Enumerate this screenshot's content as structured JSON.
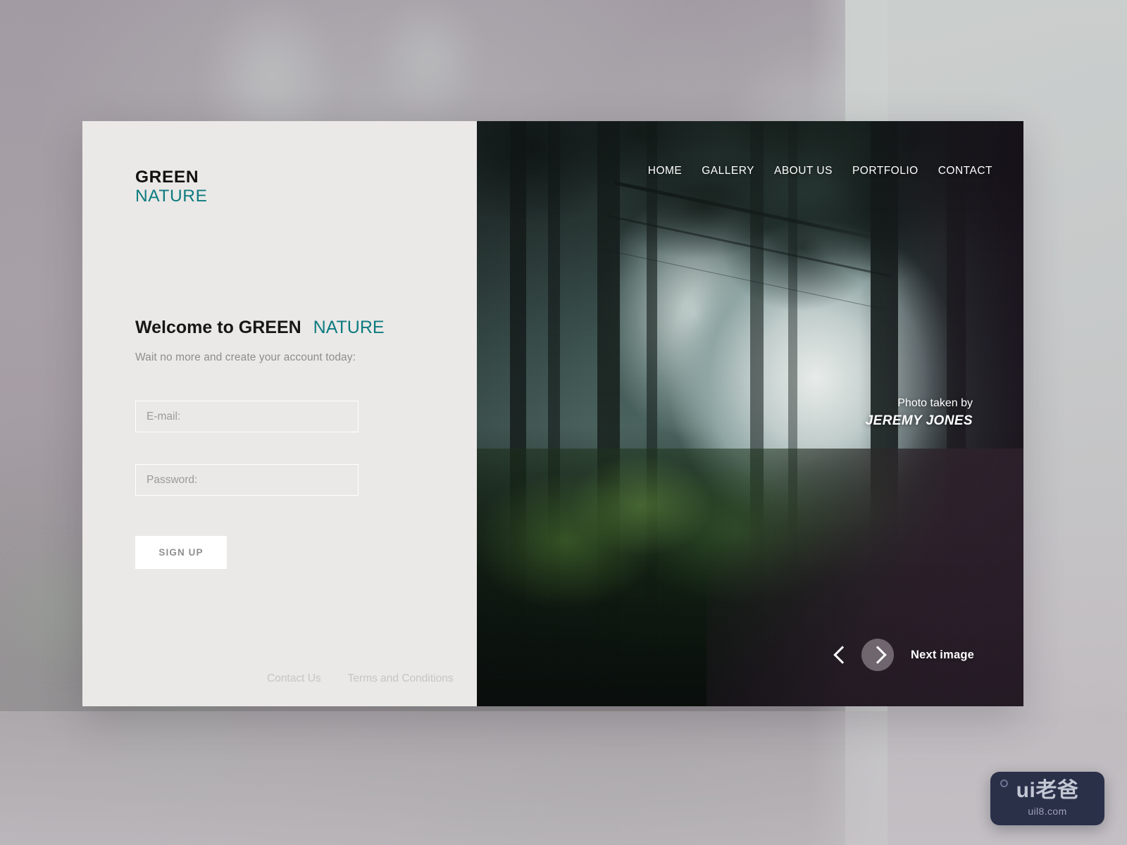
{
  "brand": {
    "line1": "GREEN",
    "line2": "NATURE",
    "accent_color": "#0d7b80"
  },
  "left_panel": {
    "heading_prefix": "Welcome to",
    "heading_brand": "GREEN",
    "heading_accent": "NATURE",
    "subtitle": "Wait no more and create your account today:",
    "form": {
      "email_placeholder": "E-mail:",
      "password_placeholder": "Password:",
      "email_value": "",
      "password_value": "",
      "submit_label": "SIGN UP"
    },
    "footer_links": [
      {
        "label": "Contact Us"
      },
      {
        "label": "Terms and Conditions"
      }
    ]
  },
  "photo_panel": {
    "nav": [
      {
        "label": "HOME"
      },
      {
        "label": "GALLERY"
      },
      {
        "label": "ABOUT US"
      },
      {
        "label": "PORTFOLIO"
      },
      {
        "label": "CONTACT"
      }
    ],
    "credit": {
      "line1": "Photo taken by",
      "line2": "JEREMY JONES"
    },
    "carousel": {
      "next_label": "Next image",
      "prev_icon": "chevron-left-icon",
      "next_icon": "chevron-right-icon"
    }
  },
  "watermark": {
    "main": "ui老爸",
    "sub": "uil8.com"
  }
}
